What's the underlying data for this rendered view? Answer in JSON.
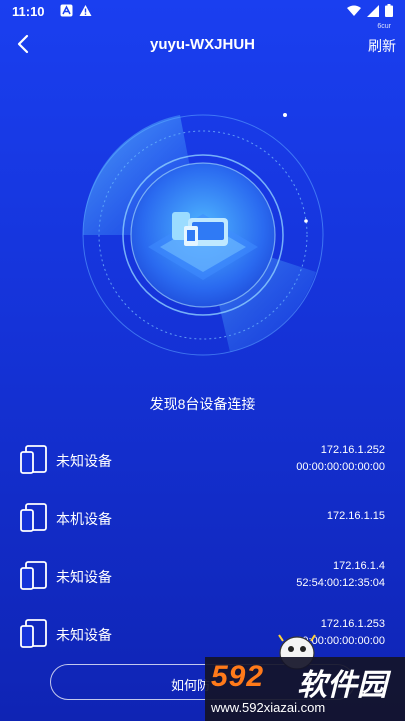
{
  "status": {
    "time": "11:10"
  },
  "header": {
    "title": "yuyu-WXJHUH",
    "refresh_label": "刷新",
    "refresh_sub": "6cur"
  },
  "scan": {
    "found_text": "发现8台设备连接"
  },
  "devices": [
    {
      "name": "未知设备",
      "ip": "172.16.1.252",
      "mac": "00:00:00:00:00:00"
    },
    {
      "name": "本机设备",
      "ip": "172.16.1.15",
      "mac": ""
    },
    {
      "name": "未知设备",
      "ip": "172.16.1.4",
      "mac": "52:54:00:12:35:04"
    },
    {
      "name": "未知设备",
      "ip": "172.16.1.253",
      "mac": "00:00:00:00:00:00"
    }
  ],
  "bottom_button": {
    "label": "如何防"
  },
  "watermark": {
    "brand_num": "592",
    "brand_cn": "软件园",
    "url": "www.592xiazai.com"
  },
  "colors": {
    "bg_top": "#1a3ff0",
    "bg_bottom": "#0f24b4",
    "accent": "#5fd2ff"
  }
}
